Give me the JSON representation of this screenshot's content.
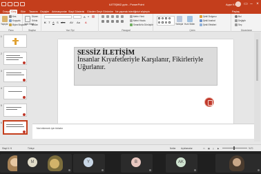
{
  "titlebar": {
    "title": "iLETiŞiM2.pptx - PowerPoint",
    "user": "Ayşe KIRLI"
  },
  "tabs": [
    "Dosya",
    "Giriş",
    "Ekle",
    "Tasarım",
    "Geçişler",
    "Animasyonlar",
    "Slayt Gösterisi",
    "Gözden Geçir",
    "Görünüm",
    "Ne yapmak istediğinizi söyleyin"
  ],
  "tabs_right": "Paylaş",
  "ribbon": {
    "groups": {
      "clipboard": "Pano",
      "slides": "Slaytlar",
      "font": "Yazı Tipi",
      "paragraph": "Paragraf",
      "drawing": "Çizim",
      "editing": "Düzenleme"
    },
    "clipboard_items": [
      "Kes",
      "Kopyala",
      "Biçim Boyacısı"
    ],
    "paste": "Yapıştır",
    "new_slide": "Yeni Slayt",
    "slide_items": [
      "Düzen",
      "Sıfırla",
      "Bölüm"
    ],
    "paragraph_items": [
      "Metin Yönü",
      "Metni Hizala",
      "SmartArt'a Dönüştür"
    ],
    "drawing_items": [
      "Şekil Dolgusu",
      "Şekil Anahat",
      "Şekil Efektleri"
    ],
    "arrange": "Yerleştir",
    "quick_styles": "Hızlı Stiller",
    "editing_items": [
      "Bul",
      "Değiştir",
      "Seç"
    ]
  },
  "slides": [
    {
      "num": "1"
    },
    {
      "num": "2"
    },
    {
      "num": "3"
    },
    {
      "num": "4"
    },
    {
      "num": "5"
    },
    {
      "num": "6"
    }
  ],
  "slide": {
    "title": "SESSİZ İLETİŞİM",
    "subtitle": "İnsanlar Kıyafetleriyle Karşılanır, Fikirleriyle Uğurlanır."
  },
  "notes_placeholder": "Not eklemek için tıklatın",
  "status": {
    "slide": "Slayt 6 / 6",
    "language": "Türkçe",
    "notes": "Notlar",
    "comments": "Açıklamalar",
    "zoom": "%70"
  },
  "participants": [
    {
      "initial": "",
      "color": "#c9a46b",
      "type": "photo"
    },
    {
      "initial": "M",
      "color": "#e1dcc9"
    },
    {
      "initial": "",
      "color": "#c8b560",
      "type": "photo"
    },
    {
      "initial": "Y",
      "color": "#c9d7e6"
    },
    {
      "initial": "B",
      "color": "#e8c7c0"
    },
    {
      "initial": "AK",
      "color": "#cfe3d0"
    },
    {
      "initial": "",
      "color": "#6a5a4a",
      "type": "photo"
    }
  ]
}
